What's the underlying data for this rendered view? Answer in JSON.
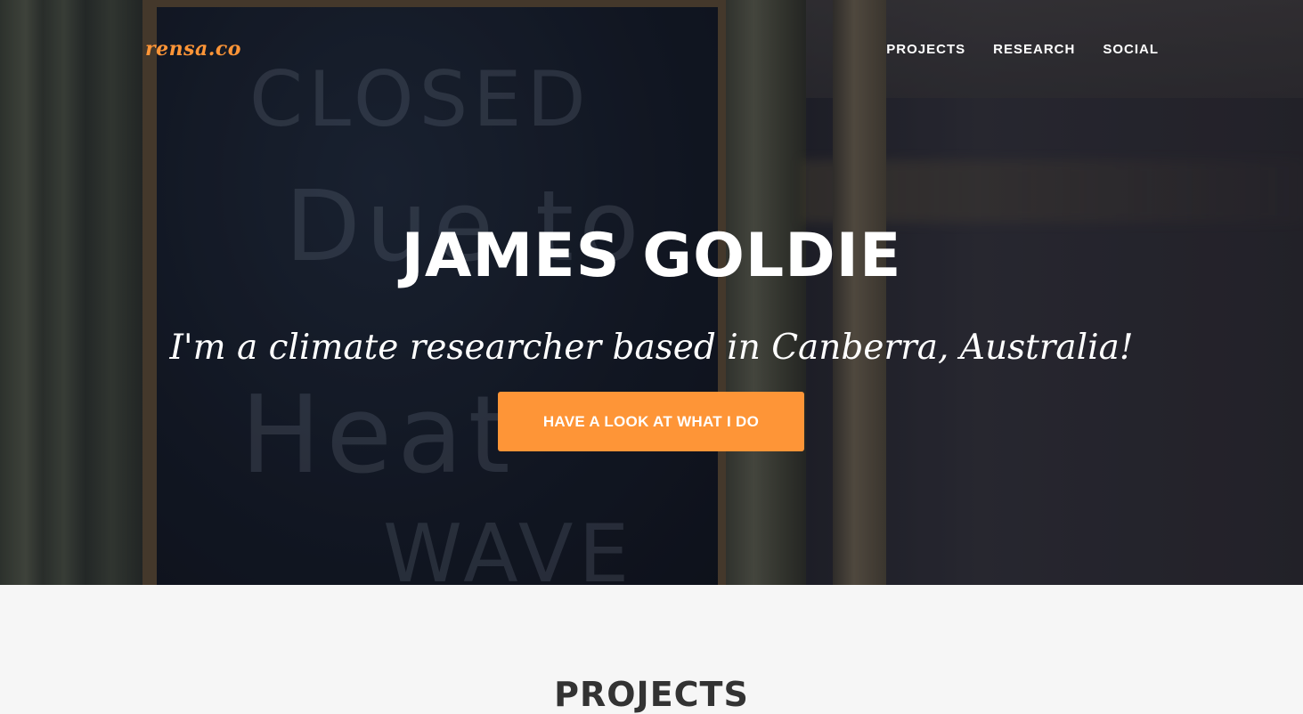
{
  "brand": {
    "logo_text": "rensa.co",
    "accent_color": "#fe9537"
  },
  "nav": {
    "items": [
      {
        "label": "PROJECTS"
      },
      {
        "label": "RESEARCH"
      },
      {
        "label": "SOCIAL"
      }
    ]
  },
  "hero": {
    "title": "JAMES GOLDIE",
    "subtitle": "I'm a climate researcher based in Canberra, Australia!",
    "cta_label": "HAVE A LOOK AT WHAT I DO",
    "background_chalk": [
      "CLOSED",
      "Due to",
      "Heat",
      "WAVE"
    ]
  },
  "projects": {
    "heading": "PROJECTS"
  }
}
